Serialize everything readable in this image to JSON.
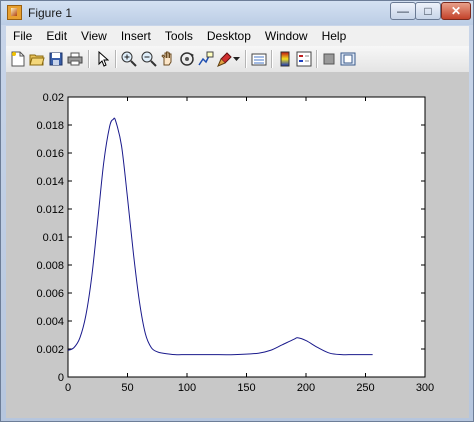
{
  "window": {
    "title": "Figure 1",
    "minimize_glyph": "—",
    "maximize_glyph": "□",
    "close_glyph": "✕"
  },
  "menu": [
    "File",
    "Edit",
    "View",
    "Insert",
    "Tools",
    "Desktop",
    "Window",
    "Help"
  ],
  "toolbar": {
    "buttons": [
      "new-figure-icon",
      "open-file-icon",
      "save-icon",
      "print-icon",
      "pointer-icon",
      "zoom-in-icon",
      "zoom-out-icon",
      "pan-icon",
      "rotate-3d-icon",
      "data-cursor-icon",
      "brush-icon",
      "brush-dropdown-icon",
      "link-plot-icon",
      "colorbar-icon",
      "legend-icon",
      "hide-plot-tools-icon",
      "show-plot-tools-icon"
    ]
  },
  "colors": {
    "line": "#1a1a8c",
    "figure_bg": "#c8c8c8",
    "axes_bg": "#ffffff"
  },
  "chart_data": {
    "type": "line",
    "xlim": [
      0,
      300
    ],
    "ylim": [
      0,
      0.02
    ],
    "x_ticks": [
      "0",
      "50",
      "100",
      "150",
      "200",
      "250",
      "300"
    ],
    "y_ticks": [
      "0",
      "0.002",
      "0.004",
      "0.006",
      "0.008",
      "0.01",
      "0.012",
      "0.014",
      "0.016",
      "0.018",
      "0.02"
    ],
    "grid": false,
    "series": [
      {
        "x": [
          0,
          5,
          10,
          15,
          20,
          25,
          30,
          35,
          38,
          40,
          45,
          50,
          55,
          60,
          65,
          70,
          75,
          80,
          90,
          100,
          120,
          140,
          160,
          170,
          180,
          190,
          193,
          200,
          210,
          220,
          230,
          240,
          256
        ],
        "y": [
          0.0019,
          0.0021,
          0.0028,
          0.0044,
          0.0072,
          0.0112,
          0.0153,
          0.0179,
          0.0184,
          0.0183,
          0.0165,
          0.0128,
          0.0088,
          0.0054,
          0.0031,
          0.0021,
          0.0018,
          0.0017,
          0.0016,
          0.0016,
          0.0016,
          0.0016,
          0.0017,
          0.0019,
          0.0023,
          0.0027,
          0.0028,
          0.0026,
          0.0021,
          0.0017,
          0.0016,
          0.0016,
          0.0016
        ]
      }
    ]
  }
}
